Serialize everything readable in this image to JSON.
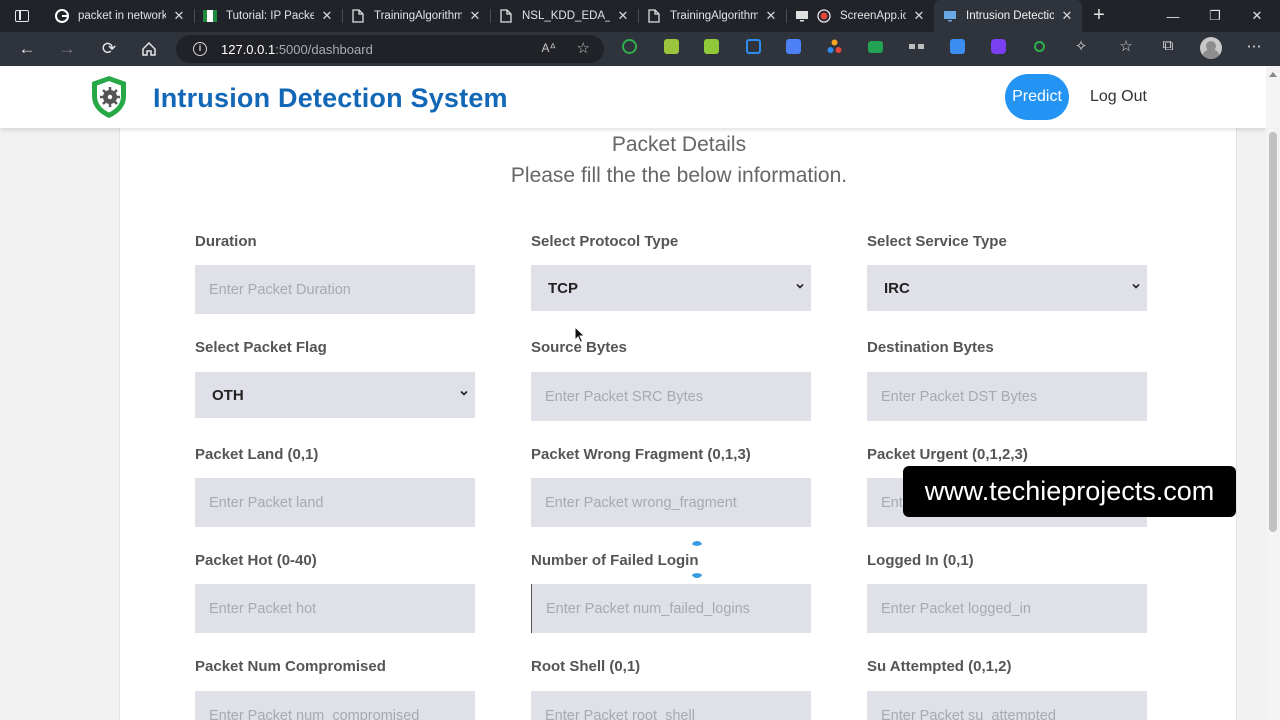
{
  "browser": {
    "tabs": [
      {
        "label": "packet in network",
        "icon": "google-icon"
      },
      {
        "label": "Tutorial: IP Packet",
        "icon": "site-icon"
      },
      {
        "label": "TrainingAlgorithm",
        "icon": "document-icon"
      },
      {
        "label": "NSL_KDD_EDA_M",
        "icon": "document-icon"
      },
      {
        "label": "TrainingAlgorithm",
        "icon": "document-icon"
      },
      {
        "label": "ScreenApp.io",
        "icon": "record-icon"
      },
      {
        "label": "Intrusion Detection",
        "icon": "monitor-icon",
        "active": true
      }
    ],
    "url_host": "127.0.0.1",
    "url_rest": ":5000/dashboard",
    "reader_label": "A",
    "colors": {
      "tabbar": "#20232a",
      "toolbar": "#2f333b"
    }
  },
  "header": {
    "title": "Intrusion Detection System",
    "predict_label": "Predict",
    "logout_label": "Log Out",
    "colors": {
      "title": "#1267b6",
      "predict_bg": "#2394f3",
      "logo_green": "#27a745"
    }
  },
  "form": {
    "heading": "Packet Details",
    "subheading": "Please fill the the below information.",
    "fields": {
      "duration": {
        "label": "Duration",
        "placeholder": "Enter Packet Duration"
      },
      "protocol": {
        "label": "Select Protocol Type",
        "value": "TCP"
      },
      "service": {
        "label": "Select Service Type",
        "value": "IRC"
      },
      "flag": {
        "label": "Select Packet Flag",
        "value": "OTH"
      },
      "src_bytes": {
        "label": "Source Bytes",
        "placeholder": "Enter Packet SRC Bytes"
      },
      "dst_bytes": {
        "label": "Destination Bytes",
        "placeholder": "Enter Packet DST Bytes"
      },
      "land": {
        "label": "Packet Land (0,1)",
        "placeholder": "Enter Packet land"
      },
      "wrong_fragment": {
        "label": "Packet Wrong Fragment (0,1,3)",
        "placeholder": "Enter Packet wrong_fragment"
      },
      "urgent": {
        "label": "Packet Urgent (0,1,2,3)",
        "placeholder": "Enter Packet urgent"
      },
      "hot": {
        "label": "Packet Hot (0-40)",
        "placeholder": "Enter Packet hot"
      },
      "num_failed_logins": {
        "label": "Number of Failed Login",
        "placeholder": "Enter Packet num_failed_logins"
      },
      "logged_in": {
        "label": "Logged In (0,1)",
        "placeholder": "Enter Packet logged_in"
      },
      "num_compromised": {
        "label": "Packet Num Compromised",
        "placeholder": "Enter Packet num_compromised"
      },
      "root_shell": {
        "label": "Root Shell (0,1)",
        "placeholder": "Enter Packet root_shell"
      },
      "su_attempted": {
        "label": "Su Attempted (0,1,2)",
        "placeholder": "Enter Packet su_attempted"
      }
    }
  },
  "watermark": {
    "text": "www.techieprojects.com"
  }
}
